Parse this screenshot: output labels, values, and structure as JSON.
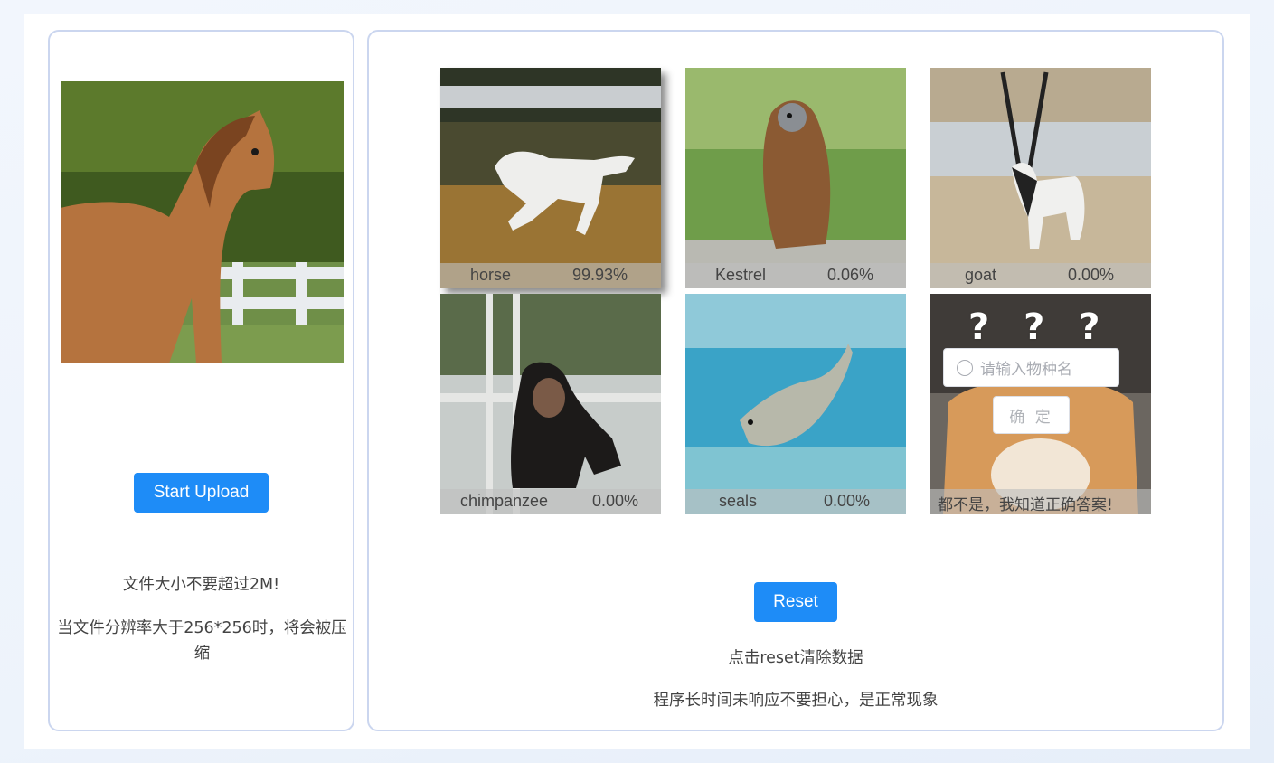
{
  "upload": {
    "button_label": "Start Upload",
    "hint_size": "文件大小不要超过2M!",
    "hint_resolution": "当文件分辨率大于256*256时，将会被压缩"
  },
  "results": [
    {
      "label": "horse",
      "percent": "99.93%",
      "image": "galloping-white-horse"
    },
    {
      "label": "Kestrel",
      "percent": "0.06%",
      "image": "kestrel-on-post"
    },
    {
      "label": "goat",
      "percent": "0.00%",
      "image": "oryx-antelope"
    },
    {
      "label": "chimpanzee",
      "percent": "0.00%",
      "image": "chimpanzee-sitting"
    },
    {
      "label": "seals",
      "percent": "0.00%",
      "image": "seal-underwater"
    }
  ],
  "custom": {
    "question_marks": "? ? ? ?",
    "input_placeholder": "请输入物种名",
    "confirm_label": "确 定",
    "caption": "都不是，我知道正确答案!"
  },
  "reset": {
    "button_label": "Reset",
    "hint_clear": "点击reset清除数据",
    "hint_wait": "程序长时间未响应不要担心，是正常现象"
  },
  "colors": {
    "primary": "#1e8cf7",
    "panel_border": "#cbd6ef",
    "page_background": "#edf3fb"
  }
}
